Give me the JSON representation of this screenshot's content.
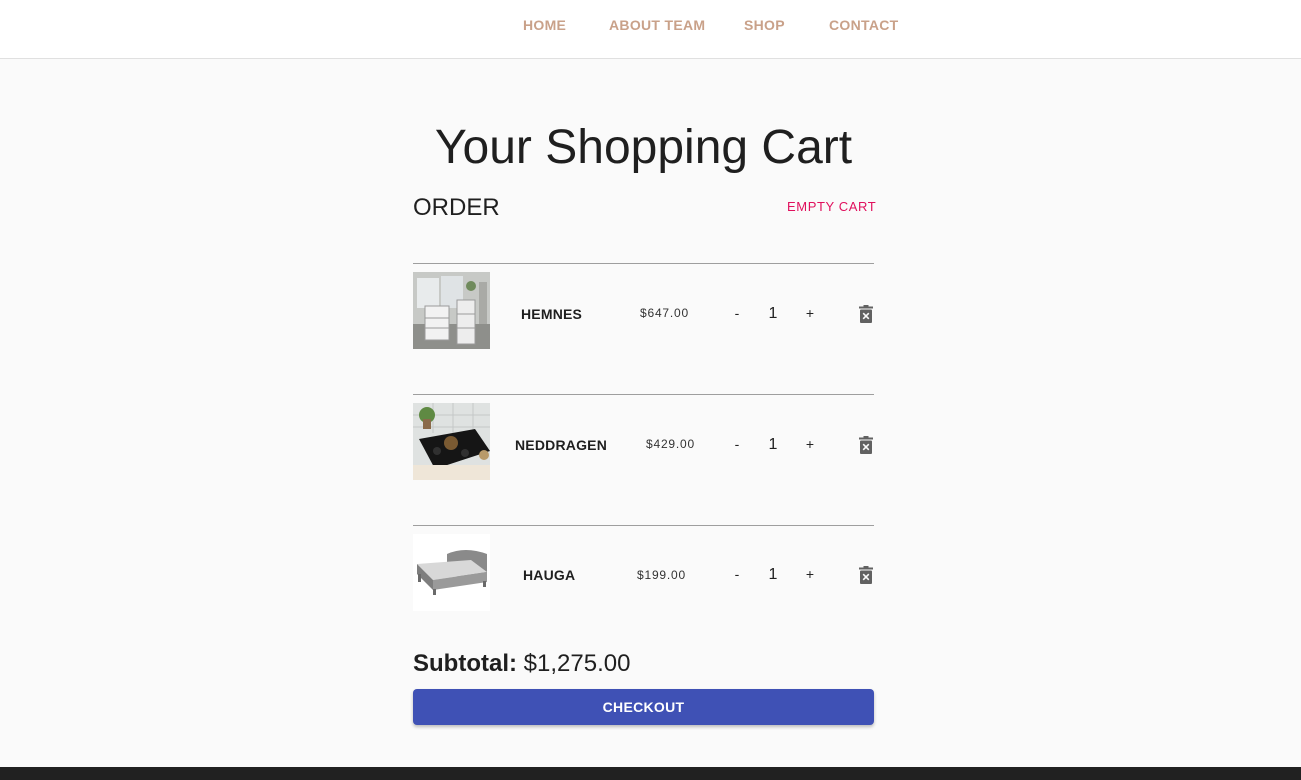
{
  "nav": {
    "items": [
      "HOME",
      "ABOUT TEAM",
      "SHOP",
      "CONTACT"
    ]
  },
  "page": {
    "title": "Your Shopping Cart",
    "order_heading": "ORDER",
    "empty_cart_label": "EMPTY CART"
  },
  "cart": {
    "items": [
      {
        "name": "HEMNES",
        "price": "$647.00",
        "quantity": "1",
        "minus": "-",
        "plus": "+"
      },
      {
        "name": "NEDDRAGEN",
        "price": "$429.00",
        "quantity": "1",
        "minus": "-",
        "plus": "+"
      },
      {
        "name": "HAUGA",
        "price": "$199.00",
        "quantity": "1",
        "minus": "-",
        "plus": "+"
      }
    ],
    "subtotal_label": "Subtotal:",
    "subtotal_value": "$1,275.00",
    "checkout_label": "CHECKOUT"
  },
  "colors": {
    "nav_link": "#c9a189",
    "empty_cart": "#e0105d",
    "checkout_button": "#3f51b5",
    "footer": "#212121"
  }
}
